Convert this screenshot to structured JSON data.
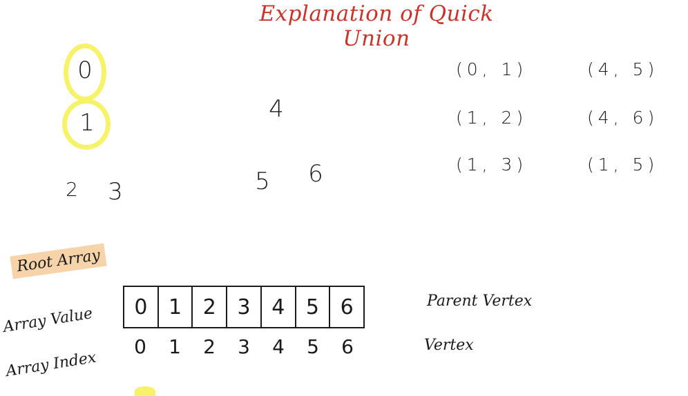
{
  "title": "Explanation of Quick Union",
  "graph": {
    "nodes": [
      "0",
      "1",
      "2",
      "3",
      "4",
      "5",
      "6"
    ]
  },
  "edges": {
    "left_column": [
      "(0, 1)",
      "(1, 2)",
      "(1, 3)"
    ],
    "right_column": [
      "(4, 5)",
      "(4, 6)",
      "(1, 5)"
    ]
  },
  "root_array": {
    "heading": "Root Array",
    "value_label": "Array Value",
    "index_label": "Array Index",
    "values": [
      "0",
      "1",
      "2",
      "3",
      "4",
      "5",
      "6"
    ],
    "indices": [
      "0",
      "1",
      "2",
      "3",
      "4",
      "5",
      "6"
    ],
    "value_meaning": "Parent Vertex",
    "index_meaning": "Vertex"
  },
  "colors": {
    "title": "#c8342c",
    "highlight": "#f6f26a",
    "label_background": "#f6d3a9"
  }
}
